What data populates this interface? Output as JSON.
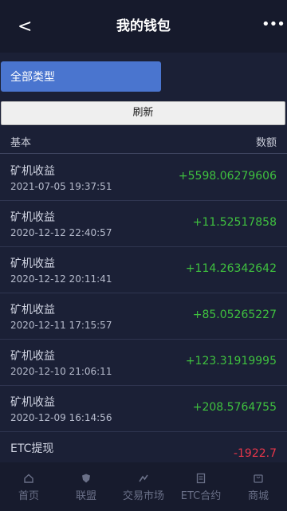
{
  "header": {
    "title": "我的钱包",
    "back_label": "<",
    "more_label": "•••"
  },
  "filter": {
    "label": "全部类型"
  },
  "refresh": {
    "label": "刷新"
  },
  "table": {
    "col_left": "基本",
    "col_right": "数额",
    "rows": [
      {
        "type": "矿机收益",
        "time": "2021-07-05 19:37:51",
        "amount": "+5598.06279606",
        "sign": "positive"
      },
      {
        "type": "矿机收益",
        "time": "2020-12-12 22:40:57",
        "amount": "+11.52517858",
        "sign": "positive"
      },
      {
        "type": "矿机收益",
        "time": "2020-12-12 20:11:41",
        "amount": "+114.26342642",
        "sign": "positive"
      },
      {
        "type": "矿机收益",
        "time": "2020-12-11 17:15:57",
        "amount": "+85.05265227",
        "sign": "positive"
      },
      {
        "type": "矿机收益",
        "time": "2020-12-10 21:06:11",
        "amount": "+123.31919995",
        "sign": "positive"
      },
      {
        "type": "矿机收益",
        "time": "2020-12-09 16:14:56",
        "amount": "+208.5764755",
        "sign": "positive"
      },
      {
        "type": "ETC提现",
        "time": "",
        "amount": "-1922.7",
        "sign": "negative"
      }
    ]
  },
  "tabbar": {
    "items": [
      {
        "label": "首页",
        "icon": "home-icon"
      },
      {
        "label": "联盟",
        "icon": "shield-icon"
      },
      {
        "label": "交易市场",
        "icon": "market-icon"
      },
      {
        "label": "ETC合约",
        "icon": "contract-icon"
      },
      {
        "label": "商城",
        "icon": "shop-icon"
      }
    ]
  },
  "colors": {
    "background": "#1b2036",
    "accent": "#4a75cf",
    "positive": "#3fc13f",
    "negative": "#e8364a"
  }
}
